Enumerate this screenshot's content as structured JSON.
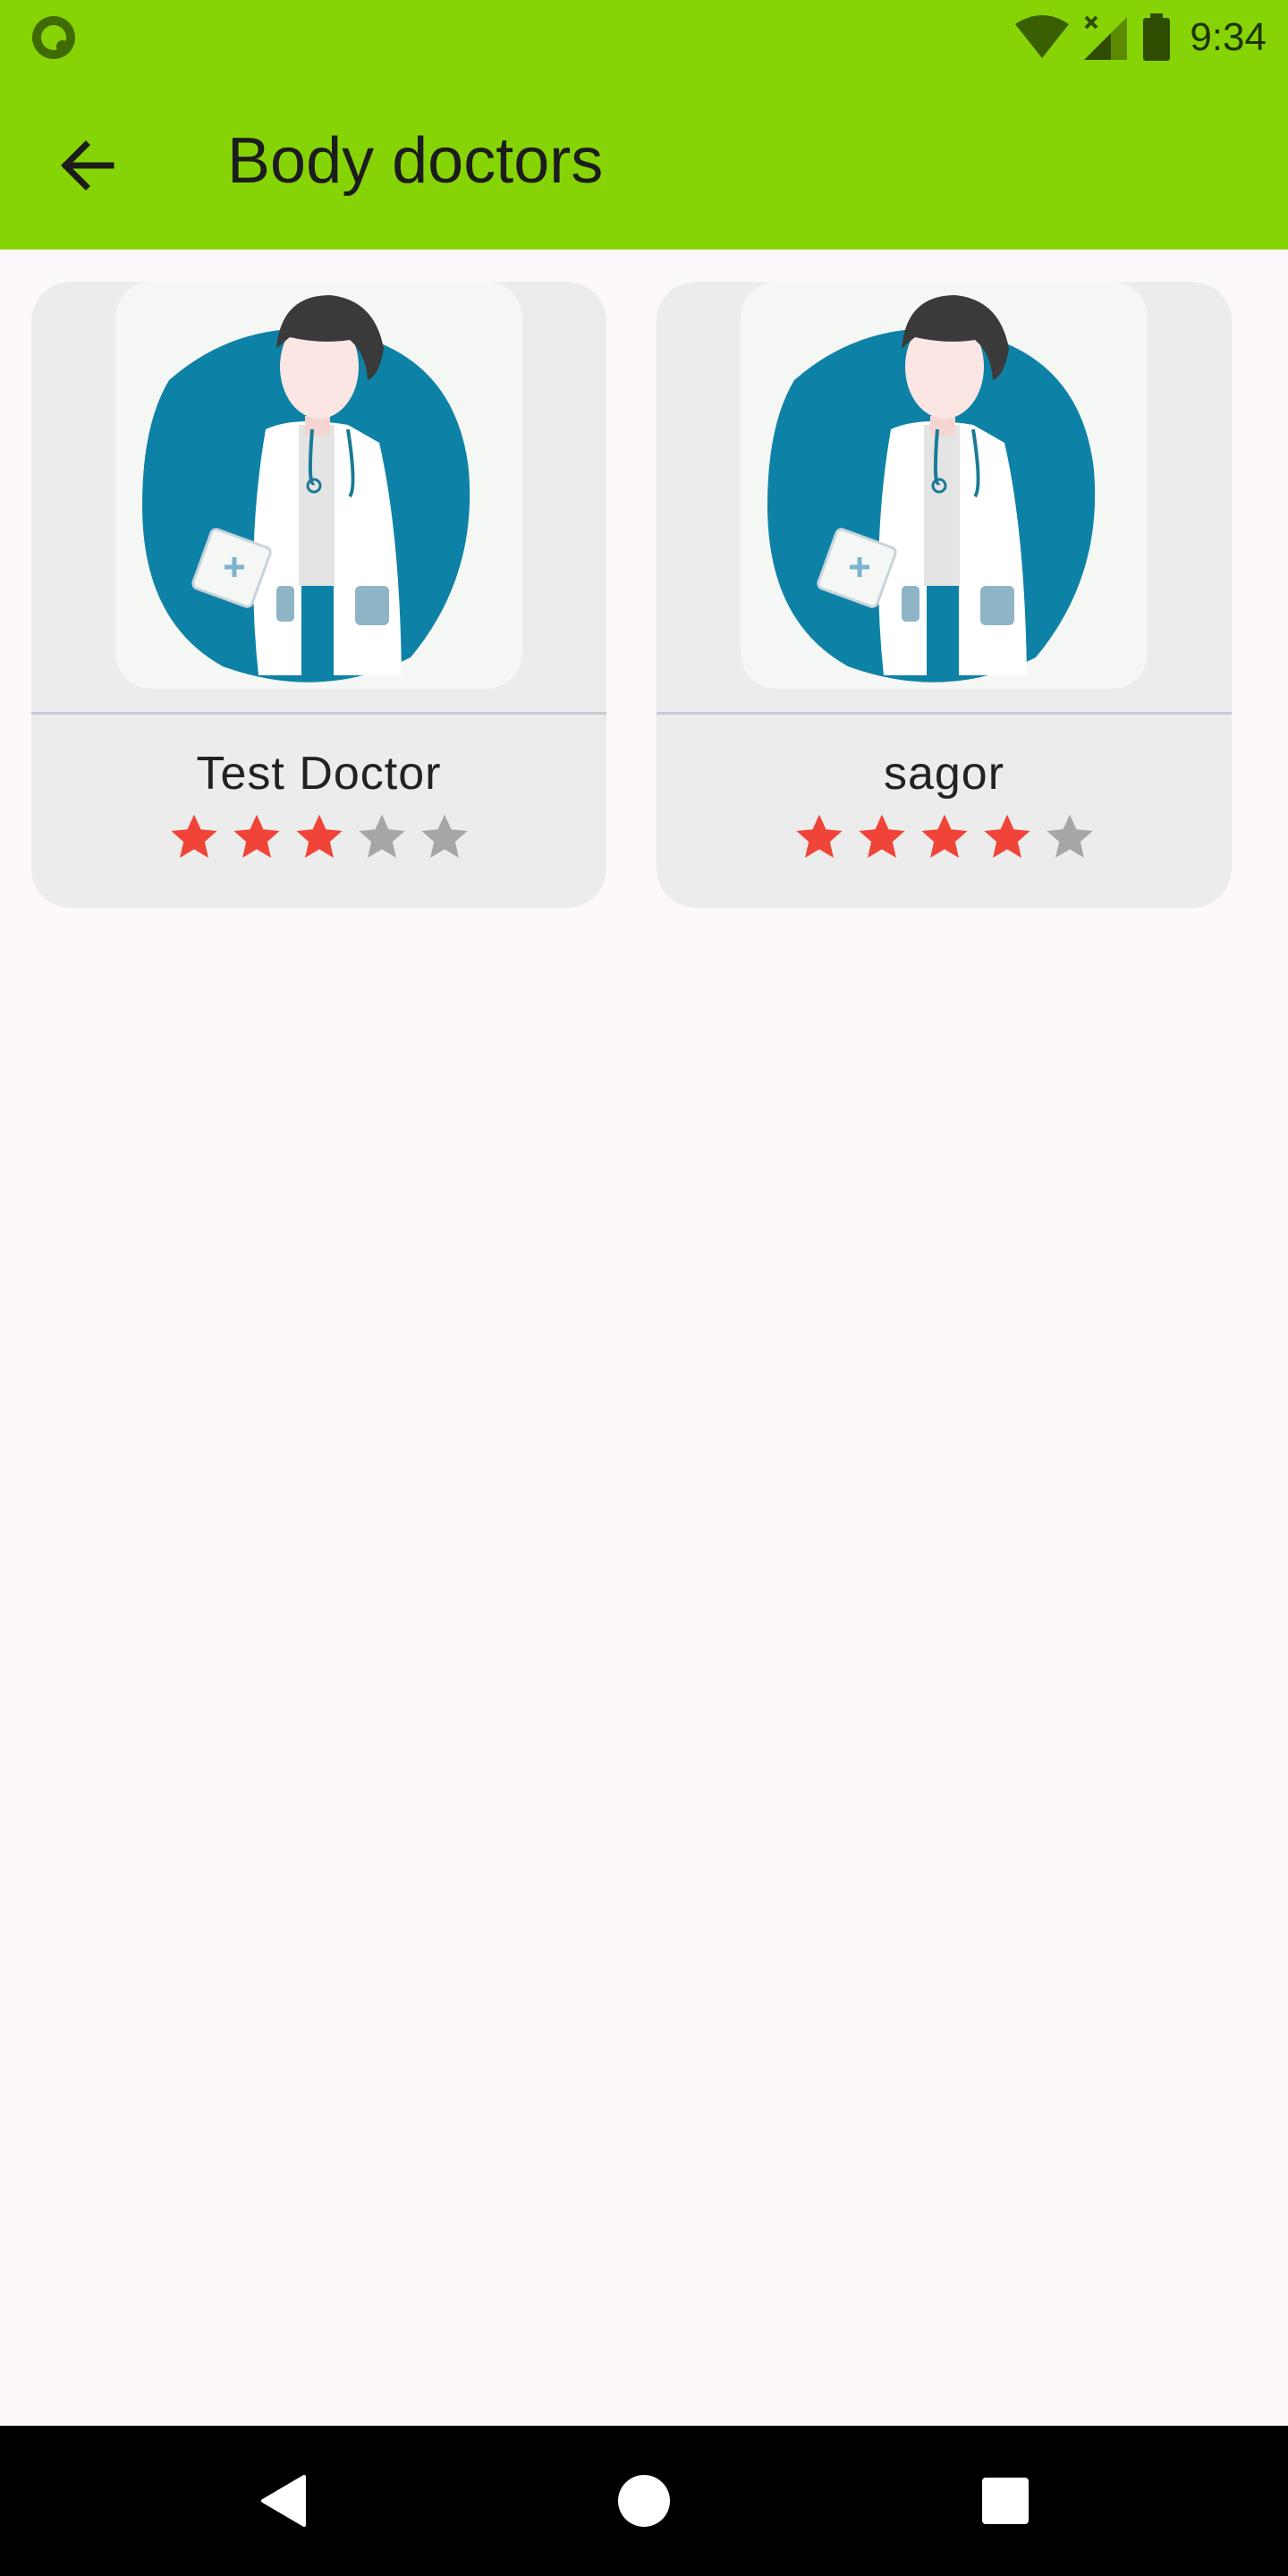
{
  "status_bar": {
    "time": "9:34",
    "icons": [
      "wifi-icon",
      "cellular-signal-icon",
      "battery-icon"
    ]
  },
  "app_bar": {
    "title": "Body doctors",
    "back_icon": "arrow-back-icon",
    "background_color": "#86d406"
  },
  "doctors": [
    {
      "name": "Test Doctor",
      "rating": 3,
      "max_rating": 5
    },
    {
      "name": "sagor",
      "rating": 4,
      "max_rating": 5
    }
  ],
  "colors": {
    "star_filled": "#f04438",
    "star_empty": "#a6a6a6",
    "avatar_circle": "#0e82a6"
  },
  "nav_bar": {
    "icons": [
      "back-triangle-icon",
      "home-circle-icon",
      "recents-square-icon"
    ]
  }
}
